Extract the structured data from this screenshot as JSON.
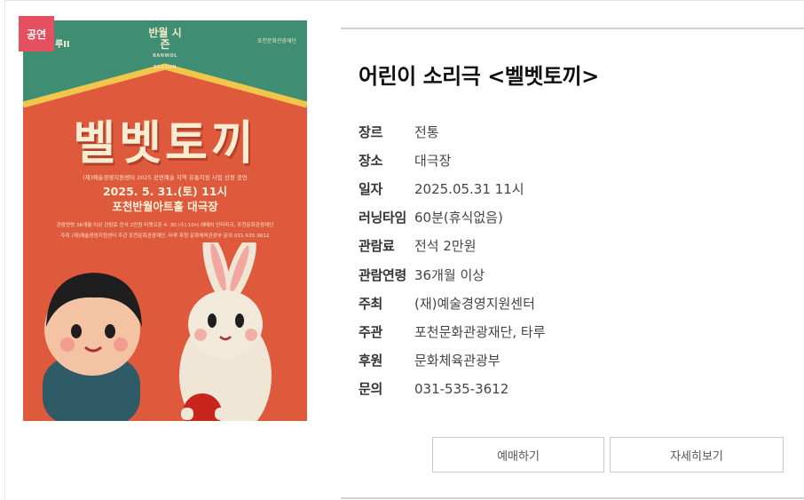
{
  "badge": "공연",
  "poster": {
    "logo_main": "반월 시즌",
    "logo_sub": "BANWOL SEASON",
    "ribbon_text": "루II",
    "sponsor_text": "포천문화관광재단",
    "title": "벨벳토끼",
    "subtitle": "(재)예술경영지원센터 2025 공연예술 지역 유통지원 사업 선정 공연",
    "date_line": "2025. 5. 31.(토) 11시",
    "venue_line": "포천반월아트홀 대극장",
    "info_line1": "관람연령 36개월 이상   관람료 전석 2만원   티켓오픈 4. 30.(수) 10시   예매처 인터파크, 포천문화관광재단",
    "info_line2": "주최 (재)예술경영지원센터   주관 포천문화관광재단, 타루   후원 문화체육관광부   문의 031-535-3612"
  },
  "detail": {
    "title": "어린이 소리극 <벨벳토끼>",
    "rows": [
      {
        "label": "장르",
        "value": "전통"
      },
      {
        "label": "장소",
        "value": "대극장"
      },
      {
        "label": "일자",
        "value": "2025.05.31 11시"
      },
      {
        "label": "러닝타임",
        "value": "60분(휴식없음)"
      },
      {
        "label": "관람료",
        "value": "전석 2만원"
      },
      {
        "label": "관람연령",
        "value": "36개월 이상"
      },
      {
        "label": "주최",
        "value": "(재)예술경영지원센터"
      },
      {
        "label": "주관",
        "value": "포천문화관광재단, 타루"
      },
      {
        "label": "후원",
        "value": "문화체육관광부"
      },
      {
        "label": "문의",
        "value": "031-535-3612"
      }
    ]
  },
  "buttons": {
    "reserve": "예매하기",
    "detail": "자세히보기"
  },
  "colors": {
    "badge": "#e4505f",
    "poster_bg": "#df5a3c",
    "poster_top": "#3f8e73"
  }
}
